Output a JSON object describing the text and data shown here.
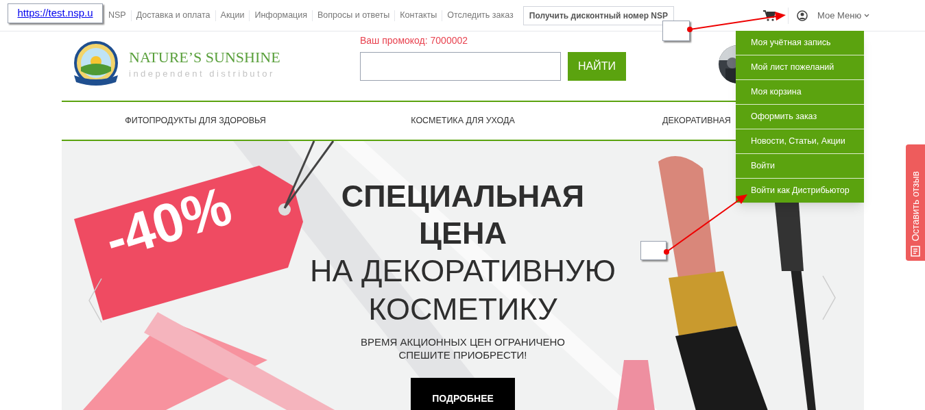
{
  "url_label": "https://test.nsp.u",
  "top_links": [
    "NSP",
    "Доставка и оплата",
    "Акции",
    "Информация",
    "Вопросы и ответы",
    "Контакты",
    "Отследить заказ"
  ],
  "discount_button": "Получить дисконтный номер NSP",
  "user_menu": {
    "label": "Мое Меню",
    "expanded": true,
    "items": [
      "Моя учётная запись",
      "Мой лист пожеланий",
      "Моя корзина",
      "Оформить заказ",
      "Новости, Статьи, Акции",
      "Войти",
      "Войти как Дистрибьютор"
    ]
  },
  "logo": {
    "name": "NATURE’S SUNSHINE",
    "tagline": "independent distributor"
  },
  "promo": "Ваш промокод: 7000002",
  "search": {
    "button": "НАЙТИ"
  },
  "categories": [
    "ФИТОПРОДУКТЫ ДЛЯ ЗДОРОВЬЯ",
    "КОСМЕТИКА ДЛЯ УХОДА",
    "ДЕКОРАТИВНАЯ"
  ],
  "banner": {
    "tag": "-40%",
    "headline_bold": [
      "СПЕЦИАЛЬНАЯ",
      "ЦЕНА"
    ],
    "headline_light": [
      "НА ДЕКОРАТИВНУЮ",
      "КОСМЕТИКУ"
    ],
    "subtitle": [
      "ВРЕМЯ АКЦИОННЫХ ЦЕН ОГРАНИЧЕНО",
      "СПЕШИТЕ ПРИОБРЕСТИ!"
    ],
    "button": "ПОДРОБНЕЕ"
  },
  "feedback_tab": "Оставить отзыв"
}
